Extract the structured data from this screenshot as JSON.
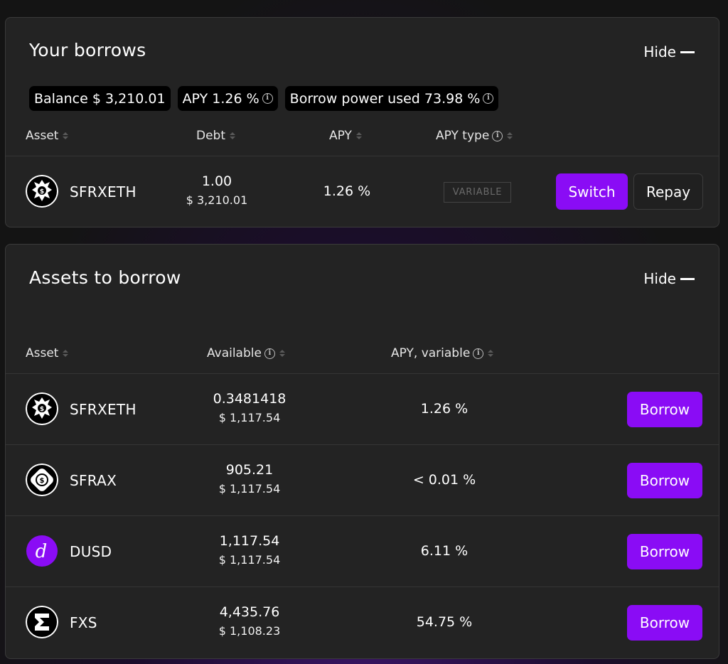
{
  "borrows": {
    "title": "Your borrows",
    "hide_label": "Hide",
    "pills": {
      "balance": "Balance $ 3,210.01",
      "apy": "APY 1.26 %",
      "borrow_power": "Borrow power used 73.98 %"
    },
    "headers": {
      "asset": "Asset",
      "debt": "Debt",
      "apy": "APY",
      "apy_type": "APY type"
    },
    "rows": [
      {
        "icon": "sfrxeth-icon",
        "asset": "SFRXETH",
        "debt": "1.00",
        "debt_usd": "$ 3,210.01",
        "apy": "1.26 %",
        "apy_type": "VARIABLE",
        "switch_label": "Switch",
        "repay_label": "Repay"
      }
    ]
  },
  "assets": {
    "title": "Assets to borrow",
    "hide_label": "Hide",
    "headers": {
      "asset": "Asset",
      "available": "Available",
      "apy_variable": "APY, variable"
    },
    "rows": [
      {
        "icon": "sfrxeth-icon",
        "asset": "SFRXETH",
        "available": "0.3481418",
        "available_usd": "$ 1,117.54",
        "apy": "1.26 %",
        "borrow_label": "Borrow"
      },
      {
        "icon": "sfrax-icon",
        "asset": "SFRAX",
        "available": "905.21",
        "available_usd": "$ 1,117.54",
        "apy": "< 0.01 %",
        "borrow_label": "Borrow"
      },
      {
        "icon": "dusd-icon",
        "asset": "DUSD",
        "available": "1,117.54",
        "available_usd": "$ 1,117.54",
        "apy": "6.11 %",
        "borrow_label": "Borrow"
      },
      {
        "icon": "fxs-icon",
        "asset": "FXS",
        "available": "4,435.76",
        "available_usd": "$ 1,108.23",
        "apy": "54.75 %",
        "borrow_label": "Borrow"
      }
    ]
  },
  "colors": {
    "accent": "#8a0cf5",
    "card_bg": "#232323",
    "dusd_icon": "#8a0cf5"
  }
}
